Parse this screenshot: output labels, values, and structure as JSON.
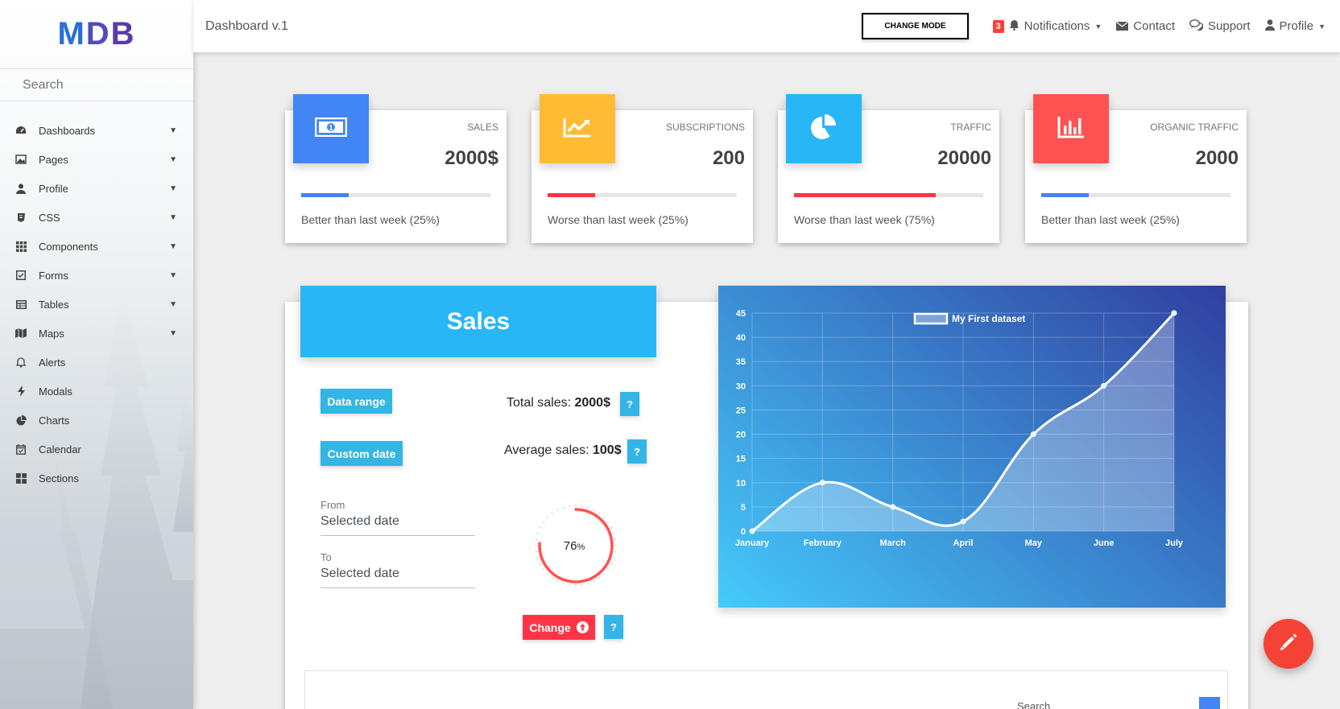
{
  "sidebar": {
    "logo": {
      "m": "M",
      "d": "D",
      "b": "B"
    },
    "search_placeholder": "Search",
    "items": [
      {
        "label": "Dashboards",
        "icon": "tachometer-icon",
        "expandable": true
      },
      {
        "label": "Pages",
        "icon": "image-icon",
        "expandable": true
      },
      {
        "label": "Profile",
        "icon": "user-icon",
        "expandable": true
      },
      {
        "label": "CSS",
        "icon": "css3-icon",
        "expandable": true
      },
      {
        "label": "Components",
        "icon": "grid-icon",
        "expandable": true
      },
      {
        "label": "Forms",
        "icon": "check-square-icon",
        "expandable": true
      },
      {
        "label": "Tables",
        "icon": "table-icon",
        "expandable": true
      },
      {
        "label": "Maps",
        "icon": "map-icon",
        "expandable": true
      },
      {
        "label": "Alerts",
        "icon": "bell-icon",
        "expandable": false
      },
      {
        "label": "Modals",
        "icon": "bolt-icon",
        "expandable": false
      },
      {
        "label": "Charts",
        "icon": "pie-chart-icon",
        "expandable": false
      },
      {
        "label": "Calendar",
        "icon": "calendar-check-icon",
        "expandable": false
      },
      {
        "label": "Sections",
        "icon": "th-large-icon",
        "expandable": false
      }
    ]
  },
  "topbar": {
    "title": "Dashboard v.1",
    "change_mode": "CHANGE MODE",
    "notifications_count": "3",
    "notifications": "Notifications",
    "contact": "Contact",
    "support": "Support",
    "profile": "Profile"
  },
  "stats": [
    {
      "label": "SALES",
      "value": "2000$",
      "desc": "Better than last week (25%)",
      "progress": 0.25,
      "color": "#4285f4",
      "bar_color": "#4285f4",
      "icon": "money-bill-icon"
    },
    {
      "label": "SUBSCRIPTIONS",
      "value": "200",
      "desc": "Worse than last week (25%)",
      "progress": 0.25,
      "color": "#ffbb33",
      "bar_color": "#ff3547",
      "icon": "chart-line-icon"
    },
    {
      "label": "TRAFFIC",
      "value": "20000",
      "desc": "Worse than last week (75%)",
      "progress": 0.75,
      "color": "#29b6f6",
      "bar_color": "#ff3547",
      "icon": "pie-chart-icon"
    },
    {
      "label": "ORGANIC TRAFFIC",
      "value": "2000",
      "desc": "Better than last week (25%)",
      "progress": 0.25,
      "color": "#ff5252",
      "bar_color": "#4285f4",
      "icon": "bar-chart-icon"
    }
  ],
  "sales": {
    "title": "Sales",
    "data_range": "Data range",
    "custom_date": "Custom date",
    "total_label": "Total sales: ",
    "total_value": "2000$",
    "average_label": "Average sales: ",
    "average_value": "100$",
    "question": "?",
    "from_label": "From",
    "from_value": "Selected date",
    "to_label": "To",
    "to_value": "Selected date",
    "gauge_value": "76",
    "gauge_unit": "%",
    "gauge_fraction": 0.76,
    "change": "Change"
  },
  "table": {
    "search_label": "Search"
  },
  "chart_data": {
    "type": "line",
    "title": "",
    "categories": [
      "January",
      "February",
      "March",
      "April",
      "May",
      "June",
      "July"
    ],
    "series": [
      {
        "name": "My First dataset",
        "values": [
          0,
          10,
          5,
          2,
          20,
          30,
          45
        ]
      }
    ],
    "ylim": [
      0,
      45
    ],
    "yticks": [
      0,
      5,
      10,
      15,
      20,
      25,
      30,
      35,
      40,
      45
    ],
    "grid": true,
    "legend": "top-center",
    "area_fill": true
  }
}
